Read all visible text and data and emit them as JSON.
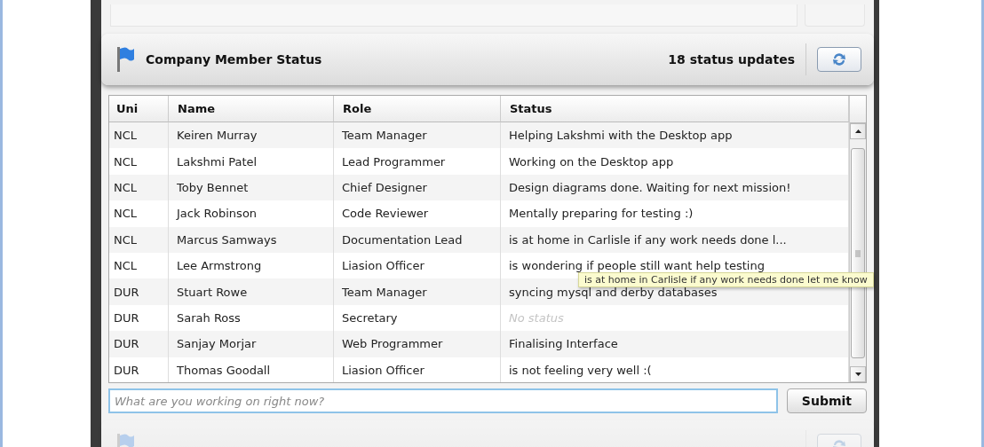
{
  "panel": {
    "title": "Company Member Status",
    "count": "18 status updates"
  },
  "table": {
    "columns": [
      "Uni",
      "Name",
      "Role",
      "Status"
    ],
    "rows": [
      {
        "uni": "NCL",
        "name": "Keiren Murray",
        "role": "Team Manager",
        "status": "Helping Lakshmi with the Desktop app",
        "muted": false
      },
      {
        "uni": "NCL",
        "name": "Lakshmi Patel",
        "role": "Lead Programmer",
        "status": "Working on the Desktop app",
        "muted": false
      },
      {
        "uni": "NCL",
        "name": "Toby Bennet",
        "role": "Chief Designer",
        "status": "Design diagrams done. Waiting for next mission!",
        "muted": false
      },
      {
        "uni": "NCL",
        "name": "Jack Robinson",
        "role": "Code Reviewer",
        "status": "Mentally preparing for testing :)",
        "muted": false
      },
      {
        "uni": "NCL",
        "name": "Marcus Samways",
        "role": "Documentation Lead",
        "status": "is at home in Carlisle if any work needs done l...",
        "muted": false
      },
      {
        "uni": "NCL",
        "name": "Lee Armstrong",
        "role": "Liasion Officer",
        "status": "is wondering if people still want help testing",
        "muted": false
      },
      {
        "uni": "DUR",
        "name": "Stuart Rowe",
        "role": "Team Manager",
        "status": "syncing mysql and derby databases",
        "muted": false
      },
      {
        "uni": "DUR",
        "name": "Sarah Ross",
        "role": "Secretary",
        "status": "No status",
        "muted": true
      },
      {
        "uni": "DUR",
        "name": "Sanjay Morjar",
        "role": "Web Programmer",
        "status": "Finalising Interface",
        "muted": false
      },
      {
        "uni": "DUR",
        "name": "Thomas Goodall",
        "role": "Liasion Officer",
        "status": "is not feeling very well :(",
        "muted": false
      }
    ]
  },
  "tooltip": "is at home in Carlisle if any work needs done let me know",
  "status_input": {
    "placeholder": "What are you working on right now?"
  },
  "submit": "Submit"
}
